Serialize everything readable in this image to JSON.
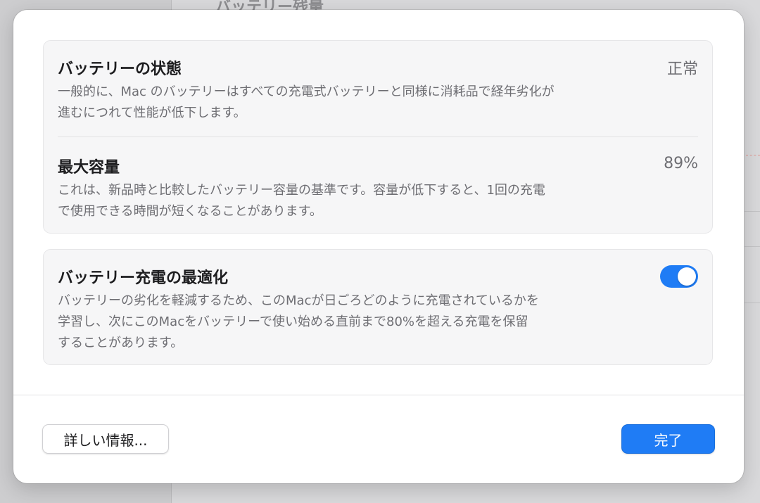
{
  "background_window": {
    "title": "バッテリー残量"
  },
  "battery_health": {
    "title": "バッテリーの状態",
    "value": "正常",
    "description_lines": [
      "一般的に、Mac のバッテリーはすべての充電式バッテリーと同様に消耗品で経年劣化が",
      "進むにつれて性能が低下します。"
    ]
  },
  "maximum_capacity": {
    "title": "最大容量",
    "value": "89%",
    "description_lines": [
      "これは、新品時と比較したバッテリー容量の基準です。容量が低下すると、1回の充電",
      "で使用できる時間が短くなることがあります。"
    ]
  },
  "optimized_charging": {
    "title": "バッテリー充電の最適化",
    "enabled": true,
    "description_lines": [
      "バッテリーの劣化を軽減するため、このMacが日ごろどのように充電されているかを",
      "学習し、次にこのMacをバッテリーで使い始める直前まで80%を超える充電を保留",
      "することがあります。"
    ]
  },
  "footer": {
    "more_info_label": "詳しい情報...",
    "done_label": "完了"
  },
  "colors": {
    "accent": "#1f7cf5",
    "secondary_text": "#6e6e73",
    "group_background": "#f6f6f7"
  }
}
